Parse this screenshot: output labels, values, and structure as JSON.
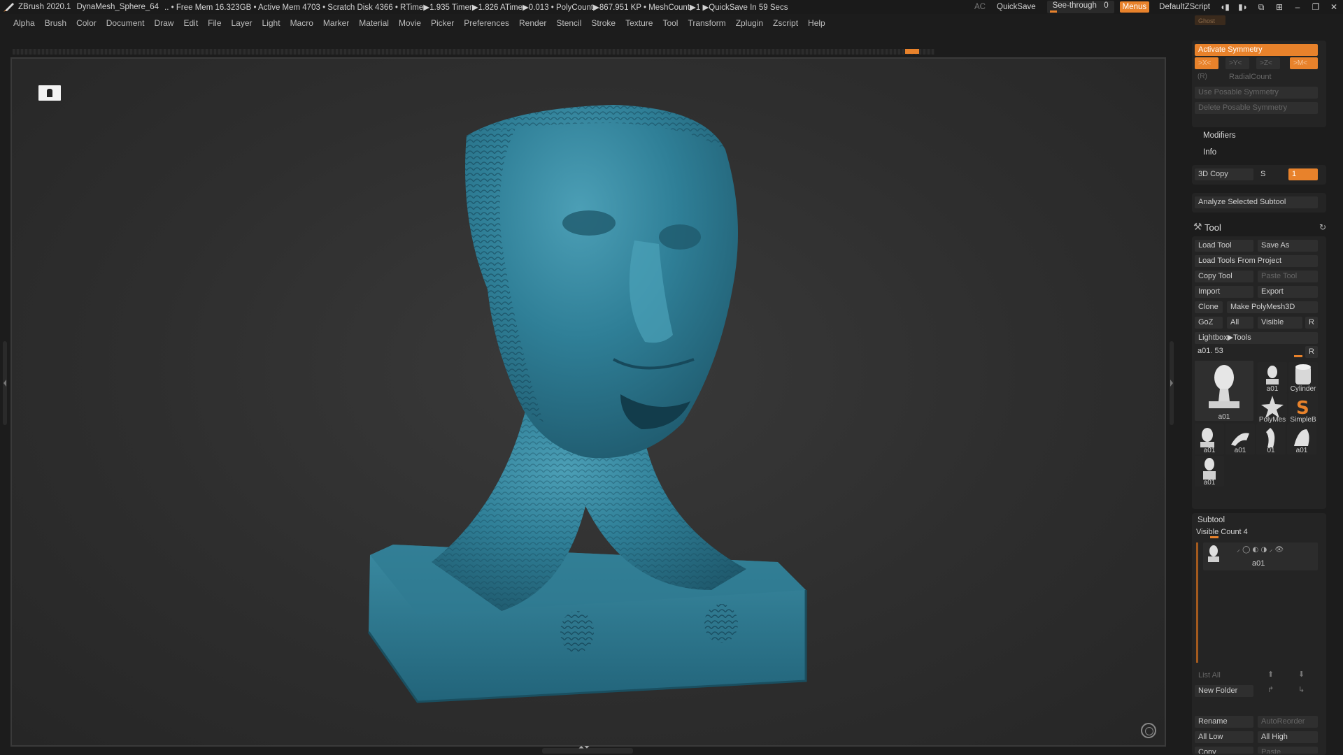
{
  "titlebar": {
    "app": "ZBrush 2020.1",
    "document": "DynaMesh_Sphere_64",
    "status": ".. • Free Mem 16.323GB • Active Mem 4703 • Scratch Disk 4366 •  RTime▶1.935 Timer▶1.826 ATime▶0.013 • PolyCount▶867.951 KP  • MeshCount▶1  ▶QuickSave In 59 Secs",
    "ac": "AC",
    "quicksave": "QuickSave",
    "seethrough_label": "See-through",
    "seethrough_value": "0",
    "menus": "Menus",
    "script": "DefaultZScript"
  },
  "menubar": [
    "Alpha",
    "Brush",
    "Color",
    "Document",
    "Draw",
    "Edit",
    "File",
    "Layer",
    "Light",
    "Macro",
    "Marker",
    "Material",
    "Movie",
    "Picker",
    "Preferences",
    "Render",
    "Stencil",
    "Stroke",
    "Texture",
    "Tool",
    "Transform",
    "Zplugin",
    "Zscript",
    "Help"
  ],
  "symmetry": {
    "ghost": "Ghost",
    "activate": "Activate Symmetry",
    "x": ">X<",
    "y": ">Y<",
    "z": ">Z<",
    "m": ">M<",
    "r": "(R)",
    "radial": "RadialCount",
    "posable": "Use Posable Symmetry",
    "delete_posable": "Delete Posable Symmetry"
  },
  "modifiers": "Modifiers",
  "info": "Info",
  "copy3d": {
    "label": "3D Copy",
    "s": "S",
    "value": "1"
  },
  "analyze": "Analyze Selected Subtool",
  "tool": {
    "title": "Tool",
    "load": "Load Tool",
    "save_as": "Save As",
    "load_project": "Load Tools From Project",
    "copy": "Copy Tool",
    "paste": "Paste Tool",
    "import": "Import",
    "export": "Export",
    "clone": "Clone",
    "polymesh": "Make PolyMesh3D",
    "goz": "GoZ",
    "all": "All",
    "visible": "Visible",
    "r": "R",
    "lightbox": "Lightbox▶Tools",
    "current": "a01. 53",
    "current_r": "R",
    "thumbs": [
      "a01",
      "a01",
      "Cylinder",
      "PolyMes",
      "SimpleB",
      "a01",
      "a01",
      "01",
      "a01",
      "a01"
    ]
  },
  "subtool": {
    "title": "Subtool",
    "visible_count": "Visible Count 4",
    "item": "a01",
    "list_all": "List All",
    "new_folder": "New Folder",
    "rename": "Rename",
    "autoreorder": "AutoReorder",
    "all_low": "All Low",
    "all_high": "All High",
    "copy": "Copy",
    "paste": "Paste"
  },
  "colors": {
    "accent": "#e8822b",
    "model": "#2e7d96"
  }
}
